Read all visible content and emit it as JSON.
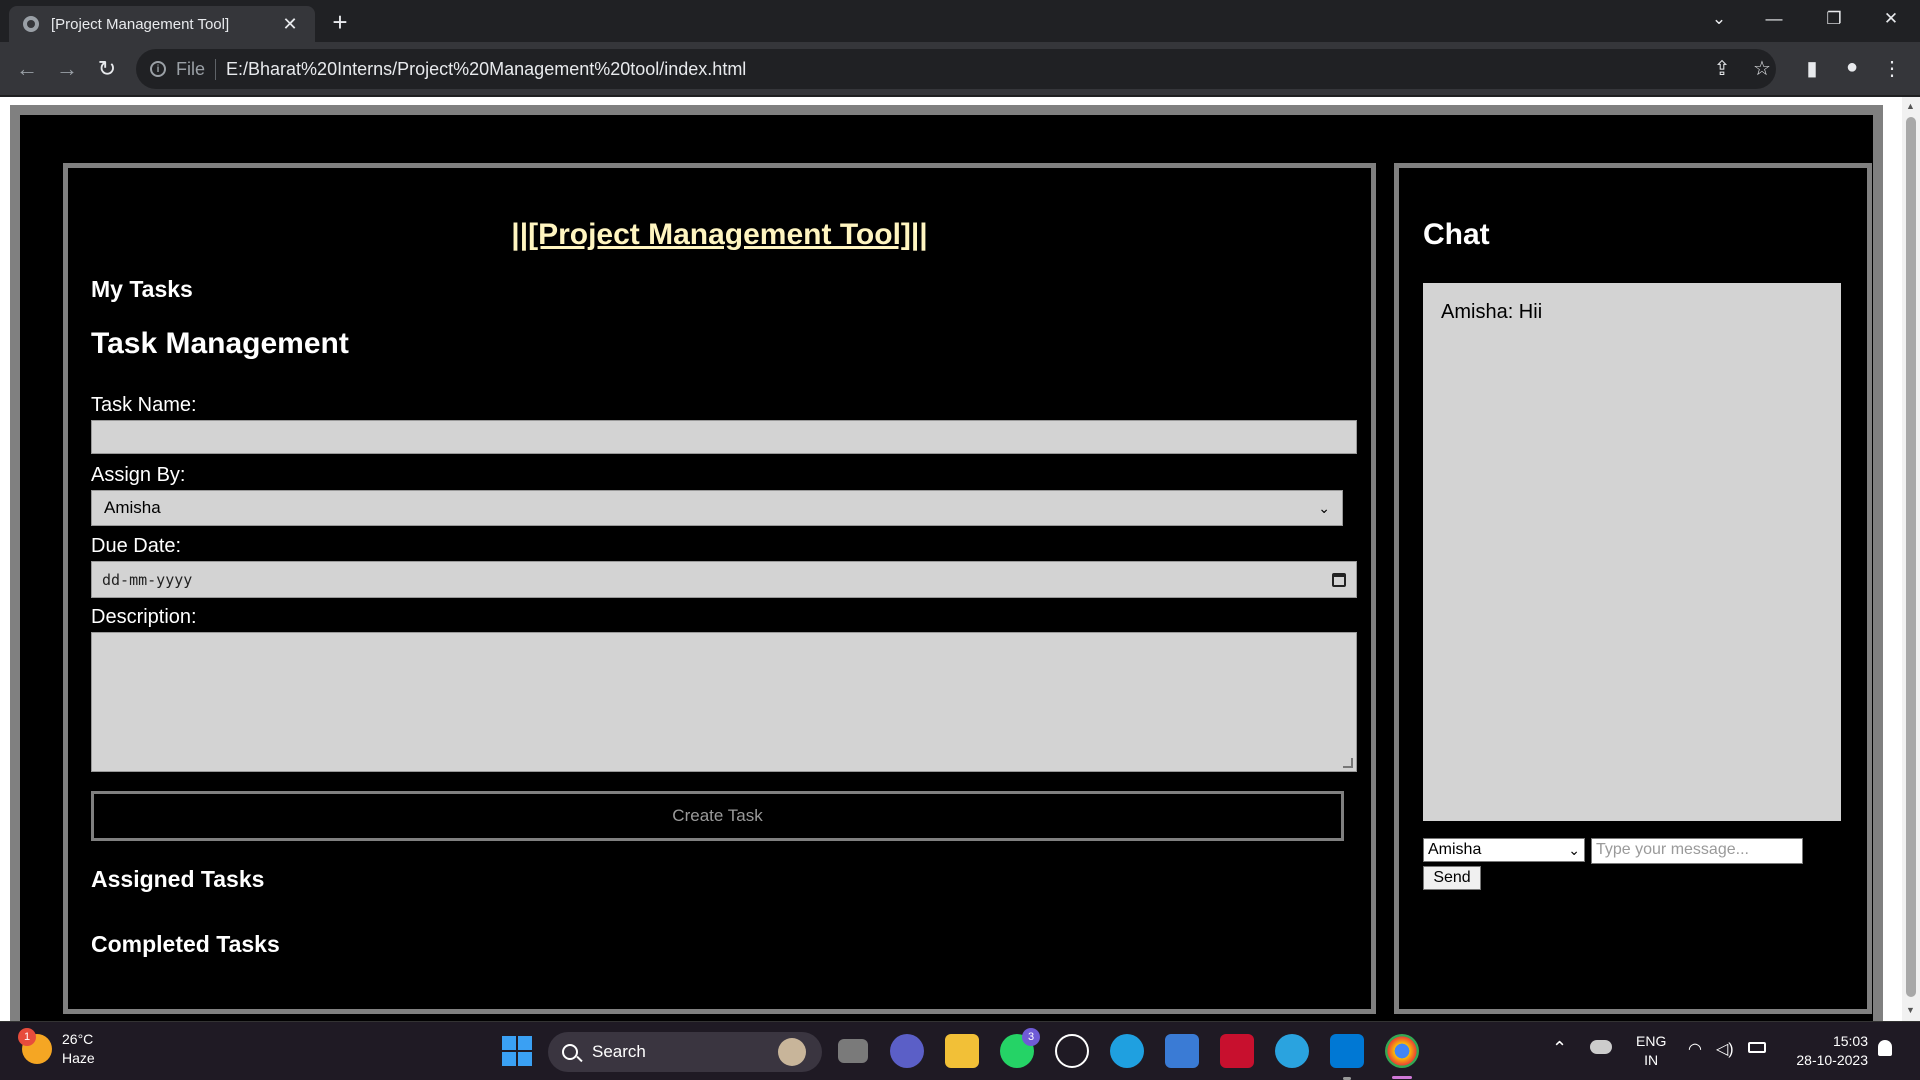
{
  "browser": {
    "tab_title": "[Project Management Tool]",
    "tab_close": "✕",
    "new_tab": "+",
    "scheme": "File",
    "url": "E:/Bharat%20Interns/Project%20Management%20tool/index.html",
    "window_controls": {
      "dropdown": "⌄",
      "minimize": "—",
      "restore": "❐",
      "close": "✕"
    },
    "nav": {
      "back": "←",
      "forward": "→",
      "reload": "↻"
    },
    "right_icons": {
      "share": "⇪",
      "bookmark": "☆",
      "sidepanel": "▮",
      "profile": "●",
      "menu": "⋮"
    }
  },
  "app": {
    "title": "||[Project Management Tool]||",
    "my_tasks_heading": "My Tasks",
    "task_management_heading": "Task Management",
    "form": {
      "task_name_label": "Task Name:",
      "task_name_value": "",
      "assign_by_label": "Assign By:",
      "assign_by_value": "Amisha",
      "due_date_label": "Due Date:",
      "due_date_placeholder": "dd-mm-yyyy",
      "description_label": "Description:",
      "description_value": "",
      "create_button": "Create Task"
    },
    "assigned_heading": "Assigned Tasks",
    "completed_heading": "Completed Tasks"
  },
  "chat": {
    "heading": "Chat",
    "messages": [
      "Amisha: Hii"
    ],
    "user_select_value": "Amisha",
    "message_placeholder": "Type your message...",
    "send_button": "Send"
  },
  "taskbar": {
    "weather_badge": "1",
    "temperature": "26°C",
    "condition": "Haze",
    "search_label": "Search",
    "whatsapp_badge": "3",
    "language_line1": "ENG",
    "language_line2": "IN",
    "time": "15:03",
    "date": "28-10-2023",
    "tray_chevron": "⌃"
  },
  "colors": {
    "page_background": "#000000",
    "panel_border": "#808080",
    "title_color": "#fff5c0",
    "field_background": "#d3d3d3",
    "taskbar_background": "#1f1a24"
  }
}
